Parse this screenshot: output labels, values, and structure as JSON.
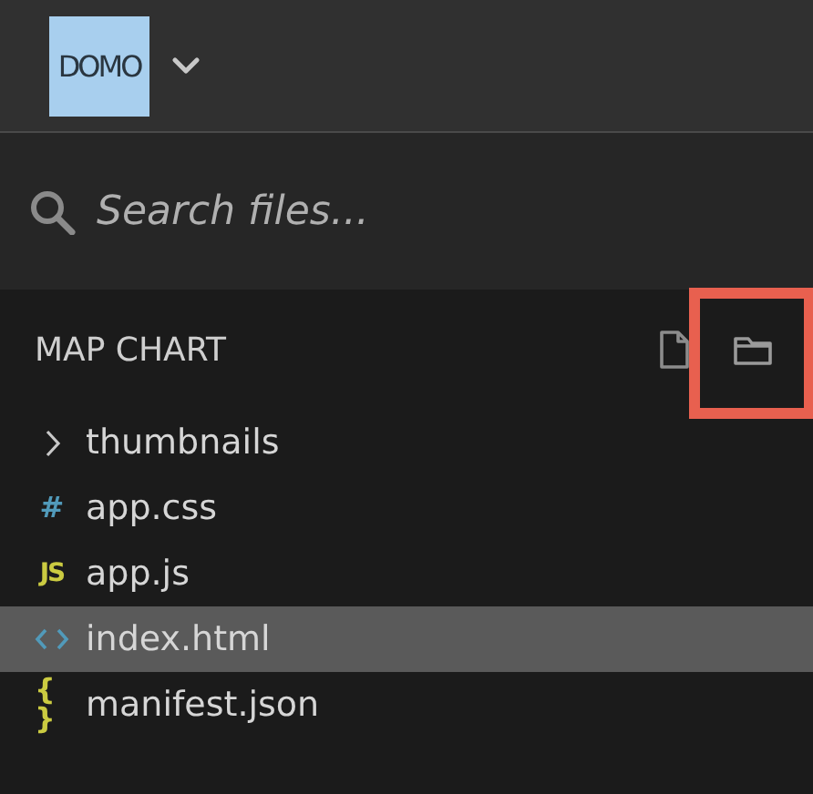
{
  "header": {
    "logo": "DOMO"
  },
  "search": {
    "placeholder": "Search files..."
  },
  "explorer": {
    "title": "MAP CHART",
    "actions": [
      {
        "kind": "new-file",
        "highlighted": false
      },
      {
        "kind": "new-folder",
        "highlighted": true
      }
    ],
    "items": [
      {
        "kind": "folder",
        "name": "thumbnails",
        "expanded": false,
        "selected": false
      },
      {
        "kind": "css",
        "icon": "#",
        "name": "app.css",
        "selected": false
      },
      {
        "kind": "js",
        "icon": "JS",
        "name": "app.js",
        "selected": false
      },
      {
        "kind": "html",
        "name": "index.html",
        "selected": true
      },
      {
        "kind": "json",
        "icon": "{ }",
        "name": "manifest.json",
        "selected": false
      }
    ]
  }
}
